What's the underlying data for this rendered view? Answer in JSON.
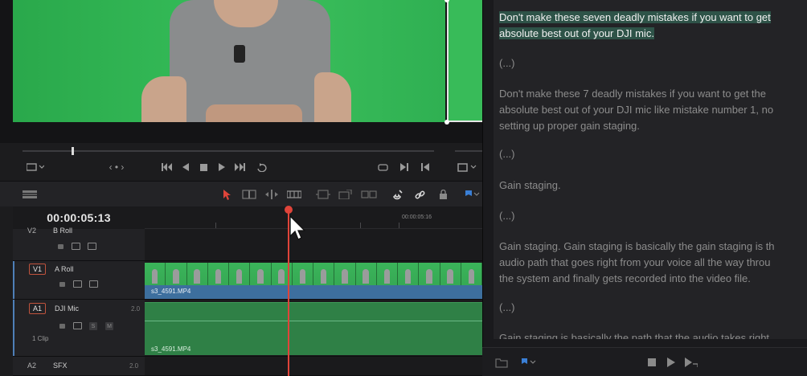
{
  "timeline": {
    "timecode": "00:00:05:13",
    "ruler_label": "00:00:05:16",
    "tracks": [
      {
        "id": "V2",
        "name": "B Roll",
        "level": ""
      },
      {
        "id": "V1",
        "name": "A Roll",
        "level": ""
      },
      {
        "id": "A1",
        "name": "DJI Mic",
        "level": "2.0",
        "clips": "1 Clip",
        "solo": "S",
        "mute": "M"
      },
      {
        "id": "A2",
        "name": "SFX",
        "level": "2.0"
      }
    ],
    "video_clip_name": "s3_4591.MP4",
    "audio_clip_name": "s3_4591.MP4"
  },
  "viewer": {
    "nav_label": "‹ • ›"
  },
  "transcript": {
    "paragraphs": [
      {
        "lines": [
          "Don't make these seven deadly mistakes if you want to get",
          "absolute best out of your DJI mic."
        ],
        "active": true
      },
      {
        "lines": [
          "(...)"
        ]
      },
      {
        "lines": [
          "Don't make these 7 deadly mistakes if you want to get the",
          "absolute best out of your DJI mic like mistake number 1, no",
          "setting up proper gain staging."
        ]
      },
      {
        "lines": [
          "(...)"
        ]
      },
      {
        "lines": [
          "Gain staging."
        ]
      },
      {
        "lines": [
          "(...)"
        ]
      },
      {
        "lines": [
          "Gain staging. Gain staging is basically the gain staging is th",
          "audio path that goes right from your voice all the way throu",
          "the system and finally gets recorded into the video file."
        ]
      },
      {
        "lines": [
          "(...)"
        ]
      },
      {
        "lines": [
          "Gain staging is basically the path that the audio takes right"
        ]
      }
    ]
  },
  "colors": {
    "playhead": "#e0443a",
    "video_clip": "#3d6f9e",
    "audio_clip": "#2f8046",
    "highlight": "#2e5348"
  }
}
